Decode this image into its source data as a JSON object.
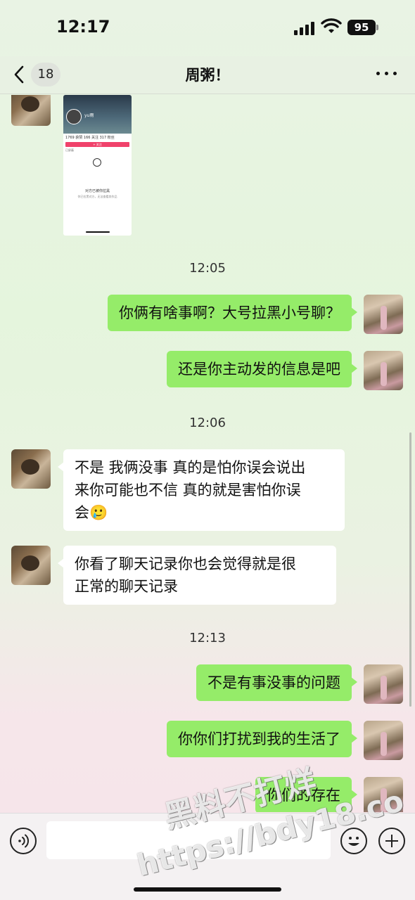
{
  "status_bar": {
    "time": "12:17",
    "battery": "95"
  },
  "header": {
    "unread_count": "18",
    "title": "周粥！"
  },
  "image_message": {
    "name": "yu雨",
    "stats": "1769 获赞   166 关注   317 粉丝",
    "button": "+ 关注",
    "small_text": "已屏蔽",
    "blocked_title": "对方已被你拉黑",
    "blocked_sub": "你已拉黑对方，无法查看其作品"
  },
  "messages": [
    {
      "type": "time",
      "text": "12:05"
    },
    {
      "type": "sent",
      "text": "你俩有啥事啊？大号拉黑小号聊？"
    },
    {
      "type": "sent",
      "text": "还是你主动发的信息是吧"
    },
    {
      "type": "time",
      "text": "12:06"
    },
    {
      "type": "received",
      "lines": [
        "不是 我俩没事 真的是怕你误会说出",
        "来你可能也不信 真的就是害怕你误",
        "会🥲"
      ]
    },
    {
      "type": "received",
      "lines": [
        "你看了聊天记录你也会觉得就是很",
        "正常的聊天记录"
      ]
    },
    {
      "type": "time",
      "text": "12:13"
    },
    {
      "type": "sent",
      "text": "不是有事没事的问题"
    },
    {
      "type": "sent",
      "text": "你你们打扰到我的生活了"
    },
    {
      "type": "sent",
      "text": "你们的存在"
    }
  ],
  "input_bar": {
    "placeholder": ""
  },
  "watermark": {
    "line1": "黑料不打烊",
    "line2": "https://bdy18.co"
  }
}
